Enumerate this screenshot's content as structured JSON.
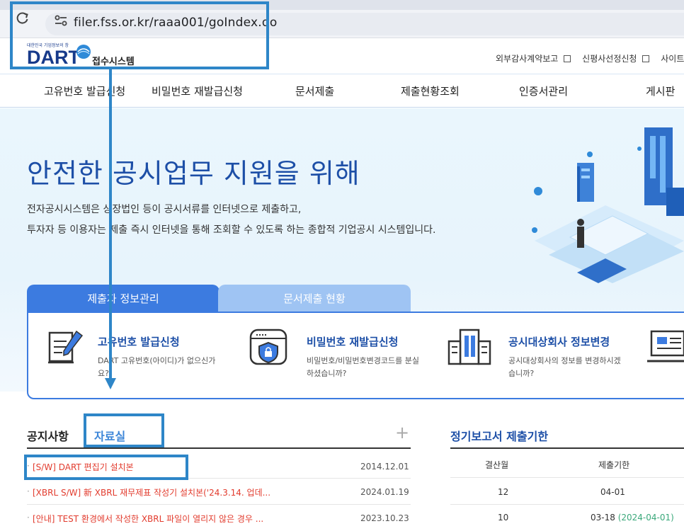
{
  "browser": {
    "url": "filer.fss.or.kr/raaa001/goIndex.do"
  },
  "header": {
    "logo_tagline": "대한민국 기업정보의 창",
    "logo_text": "DART",
    "system_name": "접수시스템",
    "util_links": [
      "외부감사계약보고",
      "신평사선정신청",
      "사이트"
    ]
  },
  "nav": {
    "items": [
      "고유번호 발급신청",
      "비밀번호 재발급신청",
      "문서제출",
      "제출현황조회",
      "인증서관리",
      "게시판"
    ]
  },
  "hero": {
    "title": "안전한 공시업무 지원을 위해",
    "desc_line1": "전자공시시스템은 상장법인 등이 공시서류를 인터넷으로 제출하고,",
    "desc_line2": "투자자 등 이용자는 제출 즉시 인터넷을 통해 조회할 수 있도록 하는 종합적 기업공시 시스템입니다."
  },
  "tabs": {
    "active": "제출자 정보관리",
    "inactive": "문서제출 현황"
  },
  "services": [
    {
      "title": "고유번호 발급신청",
      "desc": "DART 고유번호(아이디)가 없으신가요?",
      "icon": "document-pen-icon"
    },
    {
      "title": "비밀번호 재발급신청",
      "desc": "비밀번호/비밀번호변경코드를 분실하셨습니까?",
      "icon": "browser-lock-icon"
    },
    {
      "title": "공시대상회사 정보변경",
      "desc": "공시대상회사의 정보를 변경하시겠습니까?",
      "icon": "building-icon"
    },
    {
      "title": "",
      "desc": "",
      "icon": "monitor-icon"
    }
  ],
  "board": {
    "tab1": "공지사항",
    "tab2": "자료실",
    "more": "+",
    "rows": [
      {
        "title": "[S/W] DART 편집기 설치본",
        "date": "2014.12.01"
      },
      {
        "title": "[XBRL S/W] 新 XBRL 재무제표 작성기 설치본('24.3.14. 업데...",
        "date": "2024.01.19"
      },
      {
        "title": "[안내] TEST 환경에서 작성한 XBRL 파일이 열리지 않은 경우 ...",
        "date": "2023.10.23"
      }
    ]
  },
  "deadlines": {
    "title": "정기보고서 제출기한",
    "col1": "결산월",
    "col2": "제출기한",
    "rows": [
      {
        "month": "12",
        "deadline": "04-01",
        "extra": ""
      },
      {
        "month": "10",
        "deadline": "03-18",
        "extra": "(2024-04-01)"
      }
    ]
  },
  "colors": {
    "brand": "#173a8a",
    "accent": "#3c7be0",
    "annotation": "#2e86c8",
    "notice_red": "#e23b2d"
  }
}
